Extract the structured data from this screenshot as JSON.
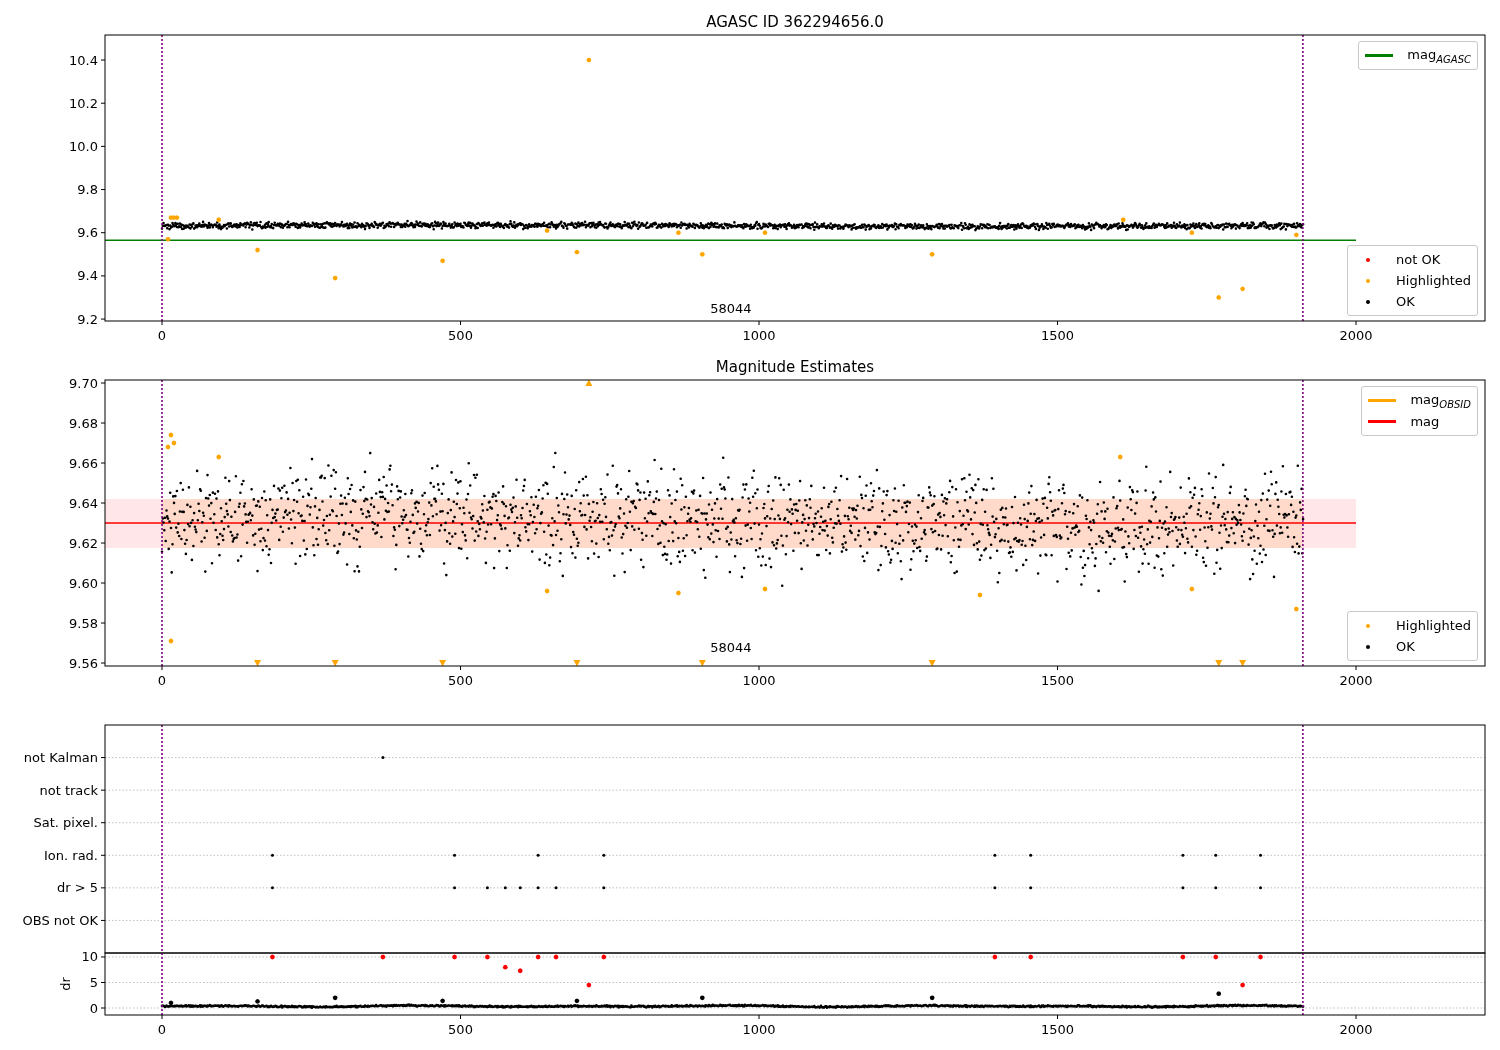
{
  "figure": {
    "charts": [
      {
        "title": "AGASC ID 362294656.0",
        "legends": [
          [
            {
              "label": "mag$_{AGASC}$",
              "color": "#008000",
              "kind": "line"
            }
          ],
          [
            {
              "label": "not OK",
              "color": "#ff0000",
              "kind": "dot"
            },
            {
              "label": "Highlighted",
              "color": "#ffa500",
              "kind": "dot"
            },
            {
              "label": "OK",
              "color": "#000000",
              "kind": "dot"
            }
          ]
        ],
        "chart_data": {
          "type": "scatter",
          "xlim": [
            -95.5,
            2216
          ],
          "ylim": [
            9.191,
            10.516
          ],
          "xticks": [
            0,
            500,
            1000,
            1500,
            2000
          ],
          "yticks": [
            {
              "value": 9.2,
              "label": "9.2"
            },
            {
              "value": 9.4,
              "label": "9.4"
            },
            {
              "value": 9.6,
              "label": "9.6"
            },
            {
              "value": 9.8,
              "label": "9.8"
            },
            {
              "value": 10.0,
              "label": "10.0"
            },
            {
              "value": 10.2,
              "label": "10.2"
            },
            {
              "value": 10.4,
              "label": "10.4"
            }
          ],
          "series": [
            {
              "color": "#008000",
              "type": "line",
              "x": [
                -95.5,
                2000
              ],
              "values": [
                9.565,
                9.565
              ]
            },
            {
              "color": "#ffa500",
              "x": [
                10,
                15,
                20,
                25,
                95,
                160,
                290,
                470,
                645,
                695,
                715,
                865,
                905,
                1010,
                1290,
                1610,
                1725,
                1770,
                1810,
                1900
              ],
              "values": [
                9.57,
                9.67,
                9.67,
                9.67,
                9.66,
                9.52,
                9.39,
                9.47,
                9.61,
                9.51,
                10.4,
                9.6,
                9.5,
                9.6,
                9.5,
                9.66,
                9.6,
                9.3,
                9.34,
                9.59
              ]
            }
          ],
          "ref_lines": [
            {
              "axis": "x",
              "value": 0,
              "color": "#800080"
            },
            {
              "axis": "x",
              "value": 1911,
              "color": "#800080"
            }
          ],
          "annotations": [
            "58044"
          ]
        }
      },
      {
        "title": "Magnitude Estimates",
        "legends": [
          [
            {
              "label": "mag$_{OBSID}$",
              "color": "#ffa500",
              "kind": "line"
            },
            {
              "label": "mag",
              "color": "#ff0000",
              "kind": "line"
            }
          ],
          [
            {
              "label": "Highlighted",
              "color": "#ffa500",
              "kind": "dot"
            },
            {
              "label": "OK",
              "color": "#000000",
              "kind": "dot"
            }
          ]
        ],
        "chart_data": {
          "type": "scatter",
          "xlim": [
            -95.5,
            2216
          ],
          "ylim": [
            9.5585,
            9.7015
          ],
          "xticks": [
            0,
            500,
            1000,
            1500,
            2000
          ],
          "yticks": [
            {
              "value": 9.56,
              "label": "9.56"
            },
            {
              "value": 9.58,
              "label": "9.58"
            },
            {
              "value": 9.6,
              "label": "9.60"
            },
            {
              "value": 9.62,
              "label": "9.62"
            },
            {
              "value": 9.64,
              "label": "9.64"
            },
            {
              "value": 9.66,
              "label": "9.66"
            },
            {
              "value": 9.68,
              "label": "9.68"
            },
            {
              "value": 9.7,
              "label": "9.70"
            }
          ],
          "series": [
            {
              "color": "#ff0000",
              "type": "line",
              "x": [
                -95.5,
                2000
              ],
              "values": [
                9.63,
                9.63
              ]
            },
            {
              "color": "#ffa500",
              "x": [
                10,
                15,
                20,
                15,
                95,
                645,
                865,
                1010,
                1370,
                1605,
                1725,
                1900,
                715,
                160,
                290,
                470,
                695,
                905,
                1290,
                1770,
                1810
              ],
              "values": [
                9.668,
                9.674,
                9.67,
                9.571,
                9.663,
                9.596,
                9.595,
                9.597,
                9.594,
                9.663,
                9.597,
                9.587,
                9.7,
                9.56,
                9.56,
                9.56,
                9.56,
                9.56,
                9.56,
                9.56,
                9.56
              ]
            }
          ],
          "bands": [
            {
              "axis": "y",
              "from": 9.6175,
              "to": 9.642,
              "color": "#ffdde1"
            },
            {
              "axis": "y",
              "from": 9.6175,
              "to": 9.642,
              "color": "#ffd6c0"
            }
          ],
          "ref_lines": [
            {
              "axis": "x",
              "value": 0,
              "color": "#800080"
            },
            {
              "axis": "x",
              "value": 1911,
              "color": "#800080"
            }
          ],
          "annotations": [
            "58044"
          ]
        }
      },
      {
        "flag_rows": [
          "not Kalman",
          "not track",
          "Sat. pixel.",
          "Ion. rad.",
          "dr > 5",
          "OBS not OK"
        ]
      },
      {
        "chart_data": {
          "type": "scatter",
          "grid": true,
          "xlim": [
            -95.5,
            2216
          ],
          "ylim": [
            -1.37,
            10.78
          ],
          "ylabel": "dr",
          "xticks": [
            0,
            500,
            1000,
            1500,
            2000
          ],
          "yticks": [
            0,
            5,
            10
          ],
          "series": [
            {
              "color": "#000000",
              "x": [
                15,
                160,
                290,
                470,
                695,
                905,
                1290,
                1770
              ],
              "values": [
                1,
                1.3,
                2,
                1.4,
                1.4,
                2,
                2,
                2.8
              ]
            },
            {
              "color": "#ff0000",
              "x": [
                575,
                600,
                715,
                1810,
                185,
                370,
                490,
                545,
                630,
                660,
                740,
                1395,
                1455,
                1710,
                1765,
                1840
              ],
              "values": [
                8,
                7.3,
                4.5,
                4.5,
                10,
                10,
                10,
                10,
                10,
                10,
                10,
                10,
                10,
                10,
                10,
                10
              ]
            }
          ],
          "ref_lines": [
            {
              "axis": "x",
              "value": 0,
              "color": "#800080"
            },
            {
              "axis": "x",
              "value": 1911,
              "color": "#800080"
            }
          ]
        }
      }
    ]
  }
}
